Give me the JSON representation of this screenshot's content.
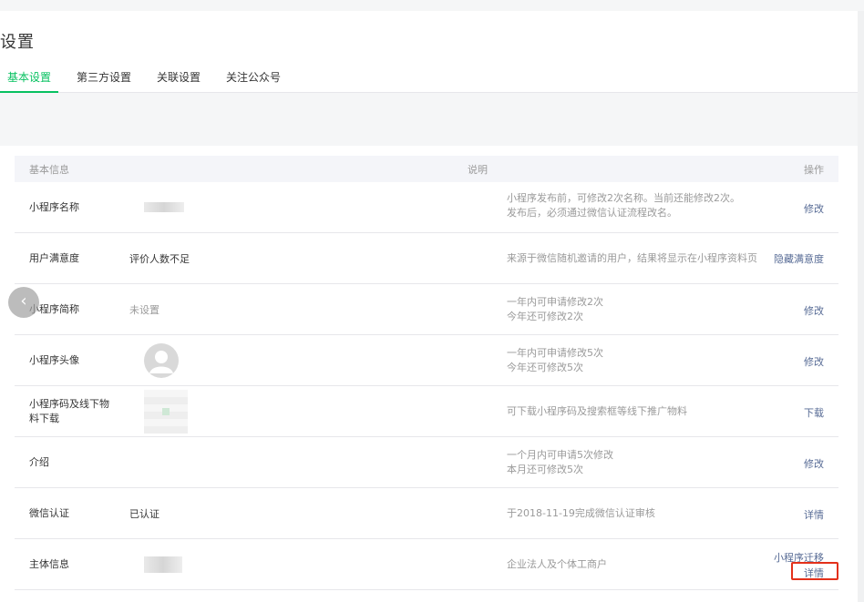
{
  "page": {
    "title": "设置"
  },
  "tabs": [
    {
      "label": "基本设置",
      "active": true
    },
    {
      "label": "第三方设置",
      "active": false
    },
    {
      "label": "关联设置",
      "active": false
    },
    {
      "label": "关注公众号",
      "active": false
    }
  ],
  "table": {
    "headers": {
      "info": "基本信息",
      "desc": "说明",
      "op": "操作"
    },
    "rows": [
      {
        "label": "小程序名称",
        "value": "",
        "desc1": "小程序发布前，可修改2次名称。当前还能修改2次。",
        "desc2": "发布后，必须通过微信认证流程改名。",
        "op": "修改"
      },
      {
        "label": "用户满意度",
        "value": "评价人数不足",
        "desc1": "来源于微信随机邀请的用户，结果将显示在小程序资料页",
        "desc2": "",
        "op": "隐藏满意度"
      },
      {
        "label": "小程序简称",
        "value": "未设置",
        "desc1": "一年内可申请修改2次",
        "desc2": "今年还可修改2次",
        "op": "修改"
      },
      {
        "label": "小程序头像",
        "value": "",
        "desc1": "一年内可申请修改5次",
        "desc2": "今年还可修改5次",
        "op": "修改"
      },
      {
        "label": "小程序码及线下物料下载",
        "value": "",
        "desc1": "可下载小程序码及搜索框等线下推广物料",
        "desc2": "",
        "op": "下载"
      },
      {
        "label": "介绍",
        "value": "",
        "desc1": "一个月内可申请5次修改",
        "desc2": "本月还可修改5次",
        "op": "修改"
      },
      {
        "label": "微信认证",
        "value": "已认证",
        "desc1": "于2018-11-19完成微信认证审核",
        "desc2": "",
        "op": "详情"
      },
      {
        "label": "主体信息",
        "value": "",
        "desc1": "企业法人及个体工商户",
        "desc2": "",
        "op": "小程序迁移",
        "op2": "详情"
      }
    ]
  },
  "colors": {
    "accent": "#07c160",
    "link": "#576b95",
    "highlight": "#e3301a"
  },
  "icons": {
    "prev": "chevron-left-icon",
    "avatar": "user-avatar-icon"
  }
}
